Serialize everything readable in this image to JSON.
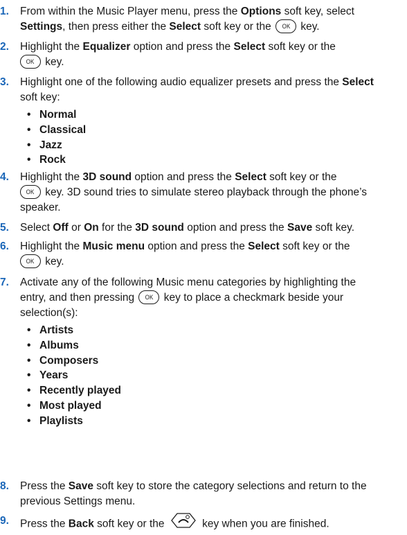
{
  "key_labels": {
    "ok": "OK",
    "ok_icon": "ok-key-icon",
    "end_icon": "end-power-key-icon"
  },
  "steps": [
    {
      "num": "1.",
      "segments": [
        "From within the Music Player menu, press the ",
        "Options",
        " soft key, select ",
        "Settings",
        ", then press either the ",
        "Select",
        " soft key or the ",
        " key."
      ]
    },
    {
      "num": "2.",
      "segments": [
        "Highlight the ",
        "Equalizer",
        " option and press the ",
        "Select",
        " soft key or the ",
        " key."
      ]
    },
    {
      "num": "3.",
      "segments": [
        "Highlight one of the following audio equalizer presets and press the ",
        "Select",
        " soft key:"
      ]
    },
    {
      "num": "4.",
      "segments": [
        "Highlight the ",
        "3D sound",
        " option and press the ",
        "Select",
        " soft key or the ",
        " key. 3D sound tries to simulate stereo playback through the phone’s speaker."
      ]
    },
    {
      "num": "5.",
      "segments": [
        "Select ",
        "Off",
        " or ",
        "On",
        " for the ",
        "3D sound",
        " option and press the ",
        "Save",
        " soft key."
      ]
    },
    {
      "num": "6.",
      "segments": [
        "Highlight the ",
        "Music menu",
        " option and press the ",
        "Select",
        " soft key or the ",
        " key."
      ]
    },
    {
      "num": "7.",
      "segments": [
        "Activate any of the following Music menu categories by highlighting the entry, and then pressing ",
        " key to place a checkmark beside your selection(s):"
      ]
    },
    {
      "num": "8.",
      "segments": [
        "Press the ",
        "Save",
        " soft key to store the category selections and return to the previous Settings menu."
      ]
    },
    {
      "num": "9.",
      "segments": [
        "Press the ",
        "Back",
        " soft key or the ",
        " key when you are finished."
      ]
    }
  ],
  "equalizer_presets": [
    "Normal",
    "Classical",
    "Jazz",
    "Rock"
  ],
  "music_categories": [
    "Artists",
    "Albums",
    "Composers",
    "Years",
    "Recently played",
    "Most played",
    "Playlists"
  ]
}
